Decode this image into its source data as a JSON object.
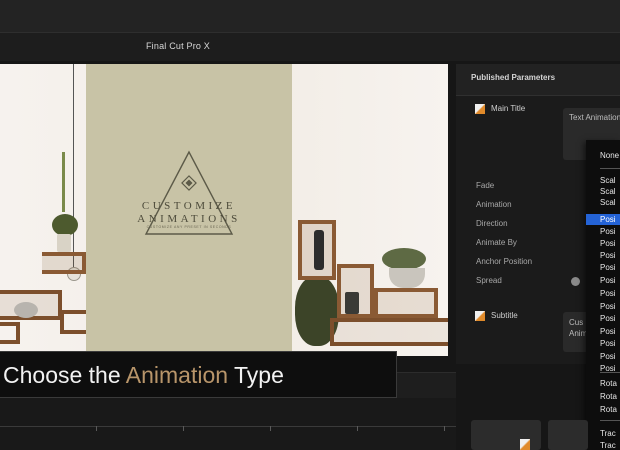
{
  "app": {
    "title": "Final Cut Pro X"
  },
  "viewer": {
    "logo_line1": "CUSTOMIZE",
    "logo_line2": "ANIMATIONS",
    "logo_tagline": "CUSTOMIZE ANY PRESET IN SECONDS"
  },
  "inspector": {
    "heading": "Published Parameters",
    "main_title": "Main Title",
    "text_animation_label": "Text Animation",
    "params": [
      "Fade",
      "Animation",
      "Direction",
      "Animate By",
      "Anchor Position",
      "Spread"
    ],
    "subtitle": "Subtitle",
    "subtitle_field_line1": "Cus",
    "subtitle_field_line2": "Anim"
  },
  "dropdown": {
    "items": [
      "None",
      "Scal",
      "Scal",
      "Scal",
      "Posi",
      "Posi",
      "Posi",
      "Posi",
      "Posi",
      "Posi",
      "Posi",
      "Posi",
      "Posi",
      "Posi",
      "Posi",
      "Posi",
      "Posi",
      "Rota",
      "Rota",
      "Rota",
      "Trac",
      "Trac"
    ],
    "selected_index": 4
  },
  "caption": {
    "before": "Choose the ",
    "accent": "Animation",
    "after": " Type",
    "accent_color": "#b8956a"
  }
}
